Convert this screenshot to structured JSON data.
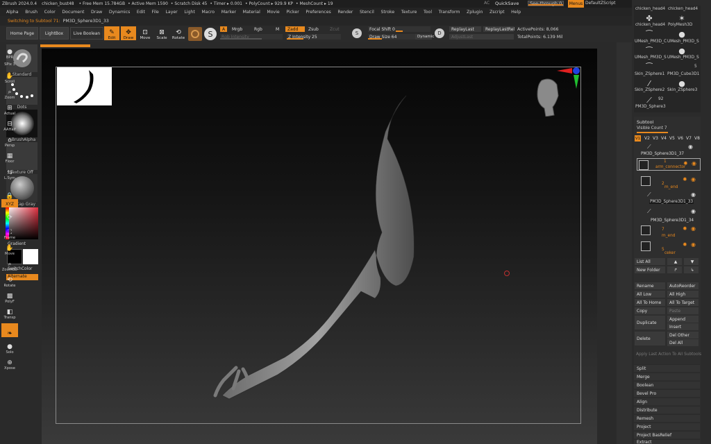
{
  "titlebar": {
    "app": "ZBrush 2024.0.4",
    "doc": "chicken_bust48",
    "free_mem": "• Free Mem 15.784GB",
    "active_mem": "• Active Mem 1590",
    "scratch": "• Scratch Disk 45",
    "timer": "• Timer ▸ 0.001",
    "polycount": "• PolyCount ▸ 929.9 KP",
    "meshcount": "• MeshCount ▸ 19",
    "ac": "AC",
    "quicksave": "QuickSave",
    "see_through": "See-through  0",
    "menus": "Menus",
    "zscript": "DefaultZScript"
  },
  "menubar": [
    "Alpha",
    "Brush",
    "Color",
    "Document",
    "Draw",
    "Dynamics",
    "Edit",
    "File",
    "Layer",
    "Light",
    "Macro",
    "Marker",
    "Material",
    "Movie",
    "Picker",
    "Preferences",
    "Render",
    "Stencil",
    "Stroke",
    "Texture",
    "Tool",
    "Transform",
    "Zplugin",
    "Zscript",
    "Help"
  ],
  "info": {
    "label": "Switching to Subtool 71:",
    "value": "PM3D_Sphere3D1_33"
  },
  "toolbar": {
    "home": "Home Page",
    "lightbox": "LightBox",
    "live_boolean": "Live Boolean",
    "edit": "Edit",
    "draw": "Draw",
    "move": "Move",
    "scale": "Scale",
    "rotate": "Rotate",
    "a": "A",
    "mrgb": "Mrgb",
    "rgb": "Rgb",
    "m": "M",
    "zadd": "Zadd",
    "zsub": "Zsub",
    "zcut": "Zcut",
    "rgb_intensity": "Rgb Intensity",
    "z_intensity": "Z Intensity 25",
    "focal": "Focal Shift 0",
    "draw_size": "Draw Size 64",
    "dynamic": "Dynamic",
    "replay": "ReplayLast",
    "replay_rel": "ReplayLastRel",
    "adjust": "AdjustLast",
    "active_points": "ActivePoints: 8,066",
    "total_points": "TotalPoints: 6.139 Mil",
    "s": "S",
    "d": "D"
  },
  "left": {
    "standard": "Standard",
    "dots": "Dots",
    "brushalpha": "~BrushAlpha",
    "texture": "Texture Off",
    "matcap": "MatCap Gray",
    "gradient": "Gradient",
    "switchcolor": "SwitchColor",
    "alternate": "Alternate"
  },
  "right_dock": [
    "BPR",
    "SPix 3",
    "Scroll",
    "Zoom",
    "Actual",
    "AAHalf",
    "Persp",
    "Floor",
    "L.Sym",
    "Frame",
    "Move",
    "Zoom3D",
    "Rotate",
    "PolyF",
    "Transp",
    "Solo",
    "Xpose"
  ],
  "tray": {
    "thumbs": [
      "chicken_head4",
      "chicken_head4",
      "chicken_head4",
      "PolyMesh3D",
      "UMesh_PM3D_C",
      "UMesh_PM3D_S",
      "UMesh_PM3D_S",
      "UMesh_PM3D_S",
      "Skin_ZSphere1",
      "PM3D_Cube3D1",
      "Skin_ZSphere2",
      "Skin_ZSphere3",
      "PM3D_Sphere3"
    ],
    "count": "92",
    "count2": "5"
  },
  "subtool": {
    "title": "Subtool",
    "visible_count": "Visible Count 7",
    "tabs": [
      "V1",
      "V2",
      "V3",
      "V4",
      "V5",
      "V6",
      "V7",
      "V8"
    ],
    "rows": [
      {
        "name": "PM3D_Sphere3D1_37",
        "orange": false
      },
      {
        "name": "1",
        "orange": true
      },
      {
        "name": "arm_connector",
        "orange": true
      },
      {
        "name": "2",
        "orange": true
      },
      {
        "name": "m_end",
        "orange": true
      },
      {
        "name": "PM3D_Sphere3D1_33",
        "orange": false
      },
      {
        "name": "PM3D_Sphere3D1_34",
        "orange": false
      },
      {
        "name": "7",
        "orange": true
      },
      {
        "name": "m_end",
        "orange": true
      },
      {
        "name": "5",
        "orange": true
      },
      {
        "name": "ceker",
        "orange": true
      }
    ]
  },
  "buttons": {
    "list_all": "List All",
    "new_folder": "New Folder",
    "rename": "Rename",
    "autoreorder": "AutoReorder",
    "all_low": "All Low",
    "all_high": "All High",
    "all_home": "All To Home",
    "all_target": "All To Target",
    "copy": "Copy",
    "paste": "Paste",
    "duplicate": "Duplicate",
    "append": "Append",
    "insert": "Insert",
    "delete": "Delete",
    "del_other": "Del Other",
    "del_all": "Del All",
    "apply_last": "Apply Last Action To All Subtools"
  },
  "sections": [
    "Split",
    "Merge",
    "Boolean",
    "Bevel Pro",
    "Align",
    "Distribute",
    "Remesh",
    "Project",
    "Project BasRelief",
    "Extract"
  ]
}
